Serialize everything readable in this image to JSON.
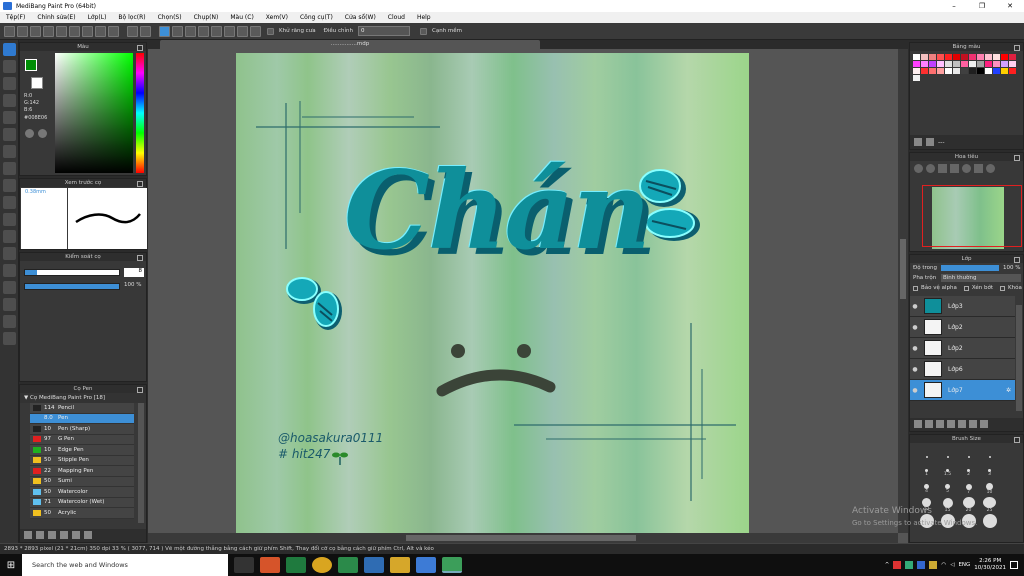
{
  "window": {
    "title": "MediBang Paint Pro (64bit)",
    "min": "–",
    "max": "❐",
    "close": "✕"
  },
  "menu": [
    "Tệp(F)",
    "Chỉnh sửa(E)",
    "Lớp(L)",
    "Bộ lọc(R)",
    "Chọn(S)",
    "Chụp(N)",
    "Màu (C)",
    "Xem(V)",
    "Công cụ(T)",
    "Cửa sổ(W)",
    "Cloud",
    "Help"
  ],
  "toolbar": {
    "antialias_label": "Khử răng cưa",
    "adjust_label": "Điều chỉnh",
    "adjust_value": "0",
    "smooth_label": "Cạnh mềm"
  },
  "doc_tab": "...............mdp",
  "color_panel": {
    "title": "Màu",
    "r": "R:0",
    "g": "G:142",
    "b": "B:6",
    "hex": "#008E06"
  },
  "preview_panel": {
    "title": "Xem trước cọ",
    "size": "0.38mm"
  },
  "brush_control": {
    "title": "Kiểm soát cọ",
    "size_value": "8",
    "opacity_value": "100 %"
  },
  "brush_panel": {
    "title": "Cọ Pen",
    "group": "Cọ MediBang Paint Pro [18]",
    "items": [
      {
        "size": "114",
        "name": "Pencil",
        "color": "#222222"
      },
      {
        "size": "8.0",
        "name": "Pen",
        "color": "#3d8fd6"
      },
      {
        "size": "10",
        "name": "Pen (Sharp)",
        "color": "#222222"
      },
      {
        "size": "97",
        "name": "G Pen",
        "color": "#e02020"
      },
      {
        "size": "10",
        "name": "Edge Pen",
        "color": "#20b020"
      },
      {
        "size": "50",
        "name": "Stipple Pen",
        "color": "#f0c020"
      },
      {
        "size": "22",
        "name": "Mapping Pen",
        "color": "#e02020"
      },
      {
        "size": "50",
        "name": "Sumi",
        "color": "#f0c020"
      },
      {
        "size": "50",
        "name": "Watercolor",
        "color": "#60c0f0"
      },
      {
        "size": "71",
        "name": "Watercolor (Wet)",
        "color": "#60c0f0"
      },
      {
        "size": "50",
        "name": "Acrylic",
        "color": "#f0c020"
      }
    ]
  },
  "palette_panel": {
    "title": "Bảng màu",
    "menu": "---"
  },
  "navigator_panel": {
    "title": "Hoa tiêu"
  },
  "layer_panel": {
    "title": "Lớp",
    "opacity_label": "Độ trong",
    "opacity_value": "100 %",
    "blend_label": "Pha trộn",
    "blend_value": "Bình thường",
    "protect_alpha": "Bảo vệ alpha",
    "clipping": "Xén bớt",
    "lock": "Khóa",
    "layers": [
      {
        "name": "Lớp3"
      },
      {
        "name": "Lớp2"
      },
      {
        "name": "Lớp2"
      },
      {
        "name": "Lớp6"
      },
      {
        "name": "Lớp7"
      }
    ]
  },
  "brush_size_panel": {
    "title": "Brush Size",
    "labels": [
      "1",
      "1.5",
      "2",
      "3",
      "4",
      "5",
      "7",
      "10",
      "12",
      "15",
      "20",
      "25"
    ]
  },
  "artwork": {
    "title": "Chán",
    "signature_line1": "@hoasakura0111",
    "signature_line2": "# hit247"
  },
  "statusbar": {
    "text": "2893 * 2893 pixel   (21 * 21cm)   350 dpi   33 %   ( 3077, 714 )   Vẽ một đường thẳng bằng cách giữ phím Shift, Thay đổi cỡ cọ bằng cách giữ phím Ctrl, Alt và kéo"
  },
  "watermark": {
    "line1": "Activate Windows",
    "line2": "Go to Settings to activate Windows."
  },
  "taskbar": {
    "search_placeholder": "Search the web and Windows",
    "lang": "ENG",
    "time": "2:26 PM",
    "date": "10/30/2021"
  },
  "colors": {
    "accent": "#3d8fd6",
    "teal": "#0f8f9a",
    "dark_teal": "#0a5f6e"
  }
}
